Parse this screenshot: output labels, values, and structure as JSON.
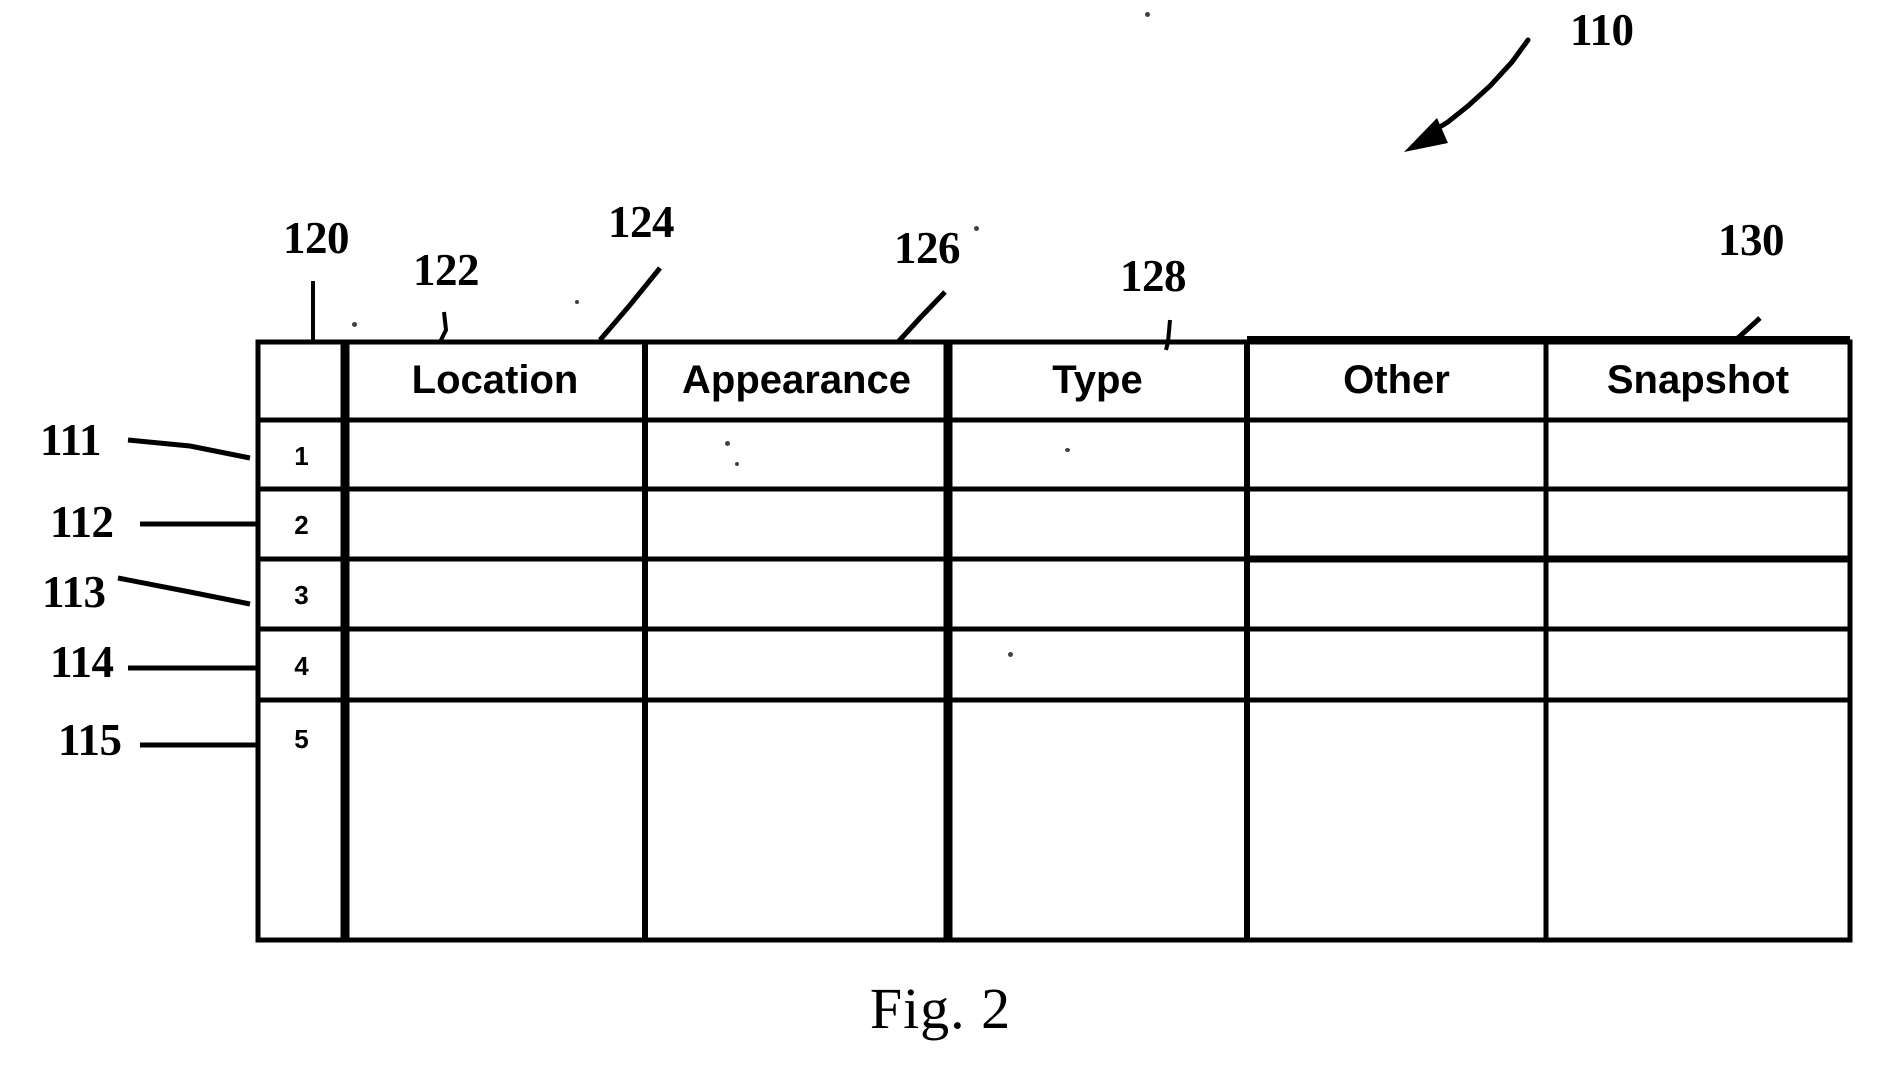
{
  "figure": {
    "caption": "Fig. 2",
    "overall_ref": "110",
    "table_ref_arrow_name": "table-callout-arrow"
  },
  "table": {
    "row_number_column_ref": "120",
    "columns": [
      {
        "header": "Location",
        "ref": "122"
      },
      {
        "header": "Appearance",
        "ref": "124"
      },
      {
        "header": "Type",
        "ref": "126"
      },
      {
        "header": "Other",
        "ref": "128"
      },
      {
        "header": "Snapshot",
        "ref": "130"
      }
    ],
    "rows": [
      {
        "number": "1",
        "ref": "111",
        "cells": [
          "",
          "",
          "",
          "",
          ""
        ]
      },
      {
        "number": "2",
        "ref": "112",
        "cells": [
          "",
          "",
          "",
          "",
          ""
        ]
      },
      {
        "number": "3",
        "ref": "113",
        "cells": [
          "",
          "",
          "",
          "",
          ""
        ]
      },
      {
        "number": "4",
        "ref": "114",
        "cells": [
          "",
          "",
          "",
          "",
          ""
        ]
      },
      {
        "number": "5",
        "ref": "115",
        "cells": [
          "",
          "",
          "",
          "",
          ""
        ]
      }
    ]
  },
  "colors": {
    "ink": "#000000",
    "paper": "#ffffff"
  }
}
